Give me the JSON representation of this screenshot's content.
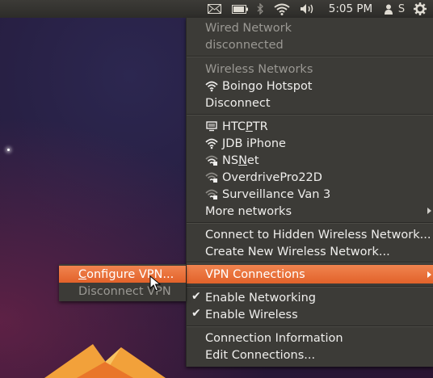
{
  "panel": {
    "clock": "5:05 PM",
    "user": "S",
    "indicators": [
      "mail-icon",
      "battery-icon",
      "bluetooth-icon",
      "wifi-icon",
      "volume-icon",
      "user-icon",
      "gear-icon"
    ]
  },
  "menu": {
    "wired_header": "Wired Network",
    "wired_status": "disconnected",
    "wireless_header": "Wireless Networks",
    "connected_network": "Boingo Hotspot",
    "disconnect": "Disconnect",
    "networks": [
      {
        "name_pre": "HTC",
        "name_mn": "P",
        "name_post": "TR",
        "icon": "computer-icon"
      },
      {
        "name_pre": "JDB iPhone",
        "name_mn": "",
        "name_post": "",
        "icon": "wifi-signal-icon"
      },
      {
        "name_pre": "NS",
        "name_mn": "N",
        "name_post": "et",
        "icon": "wifi-secure-icon"
      },
      {
        "name_pre": "OverdrivePro22D",
        "name_mn": "",
        "name_post": "",
        "icon": "wifi-secure-icon"
      },
      {
        "name_pre": "Surveillance Van 3",
        "name_mn": "",
        "name_post": "",
        "icon": "wifi-secure-icon"
      }
    ],
    "more_networks": "More networks",
    "connect_hidden": "Connect to Hidden Wireless Network...",
    "create_new": "Create New Wireless Network...",
    "vpn_connections": "VPN Connections",
    "enable_networking": "Enable Networking",
    "enable_wireless": "Enable Wireless",
    "connection_info": "Connection Information",
    "edit_connections": "Edit Connections..."
  },
  "submenu": {
    "configure_vpn_mn": "C",
    "configure_vpn_rest": "onfigure VPN...",
    "disconnect_vpn": "Disconnect VPN"
  },
  "colors": {
    "panel": "#3c3b37",
    "menu_bg": "#3c3b37",
    "highlight": "#e9692f",
    "text": "#efeeec",
    "dim_text": "#9a9893"
  }
}
